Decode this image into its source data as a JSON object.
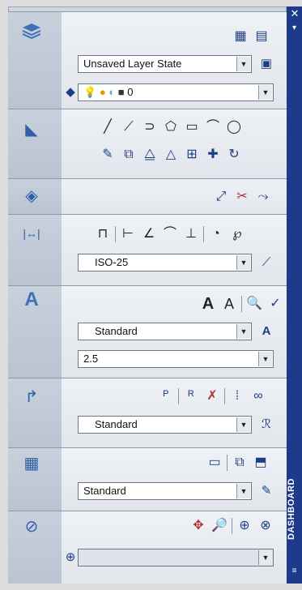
{
  "dashboard_title": "DASHBOARD",
  "window": {
    "close_glyph": "✕",
    "menu_glyph": "≡"
  },
  "layers": {
    "layer_state_value": "Unsaved Layer State",
    "current_layer_value": "0"
  },
  "dimensions": {
    "dim_style_value": "ISO-25"
  },
  "text": {
    "text_style_value": "Standard",
    "text_height_value": "2.5"
  },
  "multileader": {
    "mleader_style_value": "Standard"
  },
  "tables": {
    "table_style_value": "Standard"
  },
  "icons": {
    "layers": "layers-icon",
    "draw": "draw-icon",
    "modify": "modify-icon",
    "dimensions": "dimension-icon",
    "text": "text-icon",
    "multileader": "multileader-icon",
    "tables": "table-icon",
    "navigate": "navigation-icon"
  },
  "glyphs": {
    "text_panel_letter": "A",
    "text_big_a": "A",
    "text_multiline_a": "A"
  },
  "colors": {
    "titlebar": "#1e3a8a",
    "accent": "#2f5fa5"
  }
}
